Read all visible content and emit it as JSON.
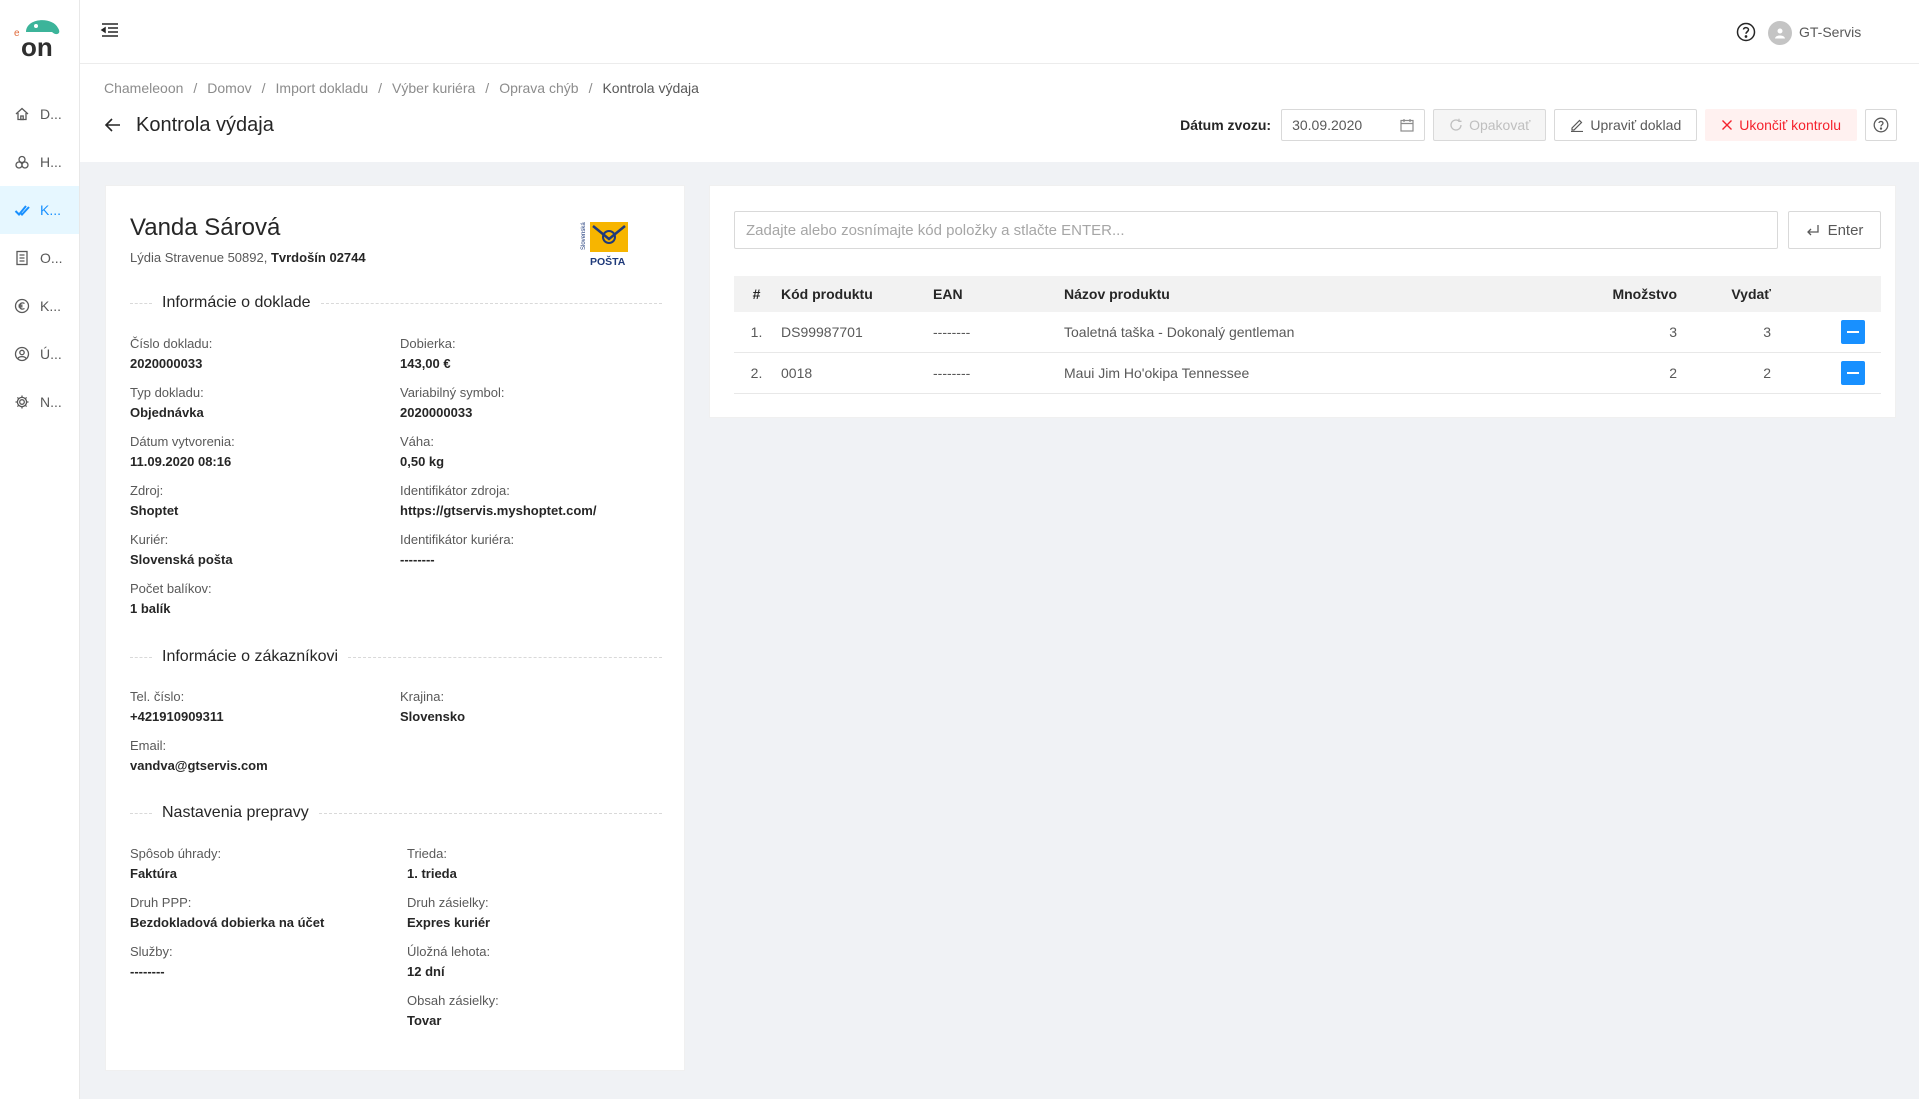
{
  "header": {
    "user_name": "GT-Servis"
  },
  "sidebar": {
    "items": [
      {
        "label": "D...",
        "icon": "home-icon"
      },
      {
        "label": "H...",
        "icon": "cubes-icon"
      },
      {
        "label": "K...",
        "icon": "double-check-icon",
        "active": true
      },
      {
        "label": "O...",
        "icon": "list-icon"
      },
      {
        "label": "K...",
        "icon": "euro-icon"
      },
      {
        "label": "Ú...",
        "icon": "user-circle-icon"
      },
      {
        "label": "N...",
        "icon": "gear-icon"
      }
    ]
  },
  "breadcrumb": [
    "Chameleoon",
    "Domov",
    "Import dokladu",
    "Výber kuriéra",
    "Oprava chýb",
    "Kontrola výdaja"
  ],
  "page": {
    "title": "Kontrola výdaja"
  },
  "toolbar": {
    "date_label": "Dátum zvozu:",
    "date_value": "30.09.2020",
    "repeat_label": "Opakovať",
    "edit_label": "Upraviť doklad",
    "end_label": "Ukončiť kontrolu"
  },
  "customer": {
    "name": "Vanda Sárová",
    "street": "Lýdia Stravenue 50892,",
    "city": "Tvrdošín 02744"
  },
  "courier_logo": {
    "line1": "Slovenská",
    "line2": "POŠTA"
  },
  "document_info": {
    "title": "Informácie o doklade",
    "fields": [
      {
        "label": "Číslo dokladu:",
        "value": "2020000033"
      },
      {
        "label": "Dobierka:",
        "value": "143,00 €"
      },
      {
        "label": "Typ dokladu:",
        "value": "Objednávka"
      },
      {
        "label": "Variabilný symbol:",
        "value": "2020000033"
      },
      {
        "label": "Dátum vytvorenia:",
        "value": "11.09.2020 08:16"
      },
      {
        "label": "Váha:",
        "value": "0,50 kg"
      },
      {
        "label": "Zdroj:",
        "value": "Shoptet"
      },
      {
        "label": "Identifikátor zdroja:",
        "value": "https://gtservis.myshoptet.com/"
      },
      {
        "label": "Kuriér:",
        "value": "Slovenská pošta"
      },
      {
        "label": "Identifikátor kuriéra:",
        "value": "--------"
      },
      {
        "label": "Počet balíkov:",
        "value": "1 balík"
      }
    ]
  },
  "customer_info": {
    "title": "Informácie o zákazníkovi",
    "fields": [
      {
        "label": "Tel. číslo:",
        "value": "+421910909311"
      },
      {
        "label": "Krajina:",
        "value": "Slovensko"
      },
      {
        "label": "Email:",
        "value": "vandva@gtservis.com"
      }
    ]
  },
  "shipping_info": {
    "title": "Nastavenia prepravy",
    "fields": [
      {
        "label": "Spôsob úhrady:",
        "value": "Faktúra"
      },
      {
        "label": "Trieda:",
        "value": "1. trieda"
      },
      {
        "label": "Druh PPP:",
        "value": "Bezdokladová dobierka na účet"
      },
      {
        "label": "Druh zásielky:",
        "value": "Expres kuriér"
      },
      {
        "label": "Služby:",
        "value": "--------"
      },
      {
        "label": "Úložná lehota:",
        "value": "12 dní"
      },
      {
        "label": "Obsah zásielky:",
        "value": "Tovar"
      }
    ]
  },
  "scan": {
    "placeholder": "Zadajte alebo zosnímajte kód položky a stlačte ENTER...",
    "enter_label": "Enter"
  },
  "table": {
    "headers": {
      "num": "#",
      "code": "Kód produktu",
      "ean": "EAN",
      "name": "Názov produktu",
      "qty": "Množstvo",
      "out": "Vydať"
    },
    "rows": [
      {
        "num": "1.",
        "code": "DS99987701",
        "ean": "--------",
        "name": "Toaletná taška - Dokonalý gentleman",
        "qty": "3",
        "out": "3"
      },
      {
        "num": "2.",
        "code": "0018",
        "ean": "--------",
        "name": "Maui Jim Ho'okipa Tennessee",
        "qty": "2",
        "out": "2"
      }
    ]
  },
  "colors": {
    "primary": "#1890ff",
    "danger": "#f5222d",
    "brand_teal": "#3cb49a"
  }
}
